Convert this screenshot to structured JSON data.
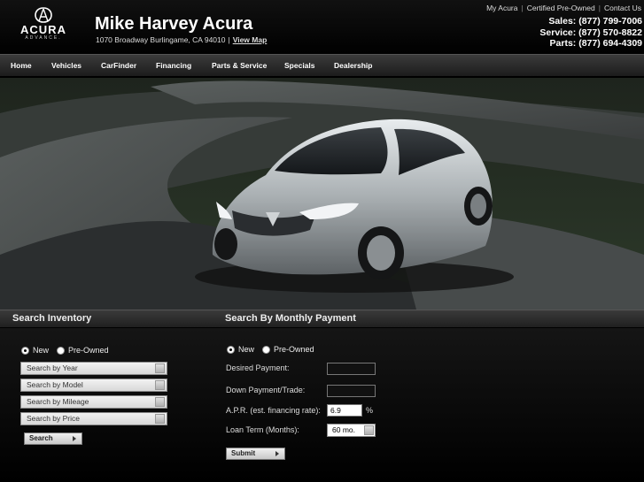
{
  "header": {
    "logo_brand": "ACURA",
    "logo_tagline": "ADVANCE.",
    "dealer_name": "Mike Harvey Acura",
    "address": "1070 Broadway Burlingame, CA 94010",
    "address_sep": "|",
    "view_map": "View Map",
    "top_links": [
      "My Acura",
      "Certified Pre-Owned",
      "Contact Us"
    ],
    "top_sep": "|",
    "phones": {
      "sales": "Sales: (877) 799-7006",
      "service": "Service: (877) 570-8822",
      "parts": "Parts: (877) 694-4309"
    }
  },
  "nav": {
    "items": [
      "Home",
      "Vehicles",
      "CarFinder",
      "Financing",
      "Parts & Service",
      "Specials",
      "Dealership"
    ]
  },
  "hero": {
    "description_icon": "car-photo"
  },
  "inventory": {
    "title": "Search Inventory",
    "radio_new": "New",
    "radio_preowned": "Pre-Owned",
    "selected": "New",
    "selects": [
      "Search by Year",
      "Search by Model",
      "Search by Mileage",
      "Search by Price"
    ],
    "search_button": "Search"
  },
  "payment": {
    "title": "Search By Monthly Payment",
    "radio_new": "New",
    "radio_preowned": "Pre-Owned",
    "selected": "New",
    "desired_label": "Desired Payment:",
    "down_label": "Down Payment/Trade:",
    "apr_label": "A.P.R. (est. financing rate):",
    "apr_value": "6.9",
    "apr_unit": "%",
    "term_label": "Loan Term (Months):",
    "term_value": "60 mo.",
    "submit_button": "Submit"
  },
  "colors": {
    "background": "#000000",
    "nav": "#2a2a2a",
    "text": "#ffffff"
  }
}
